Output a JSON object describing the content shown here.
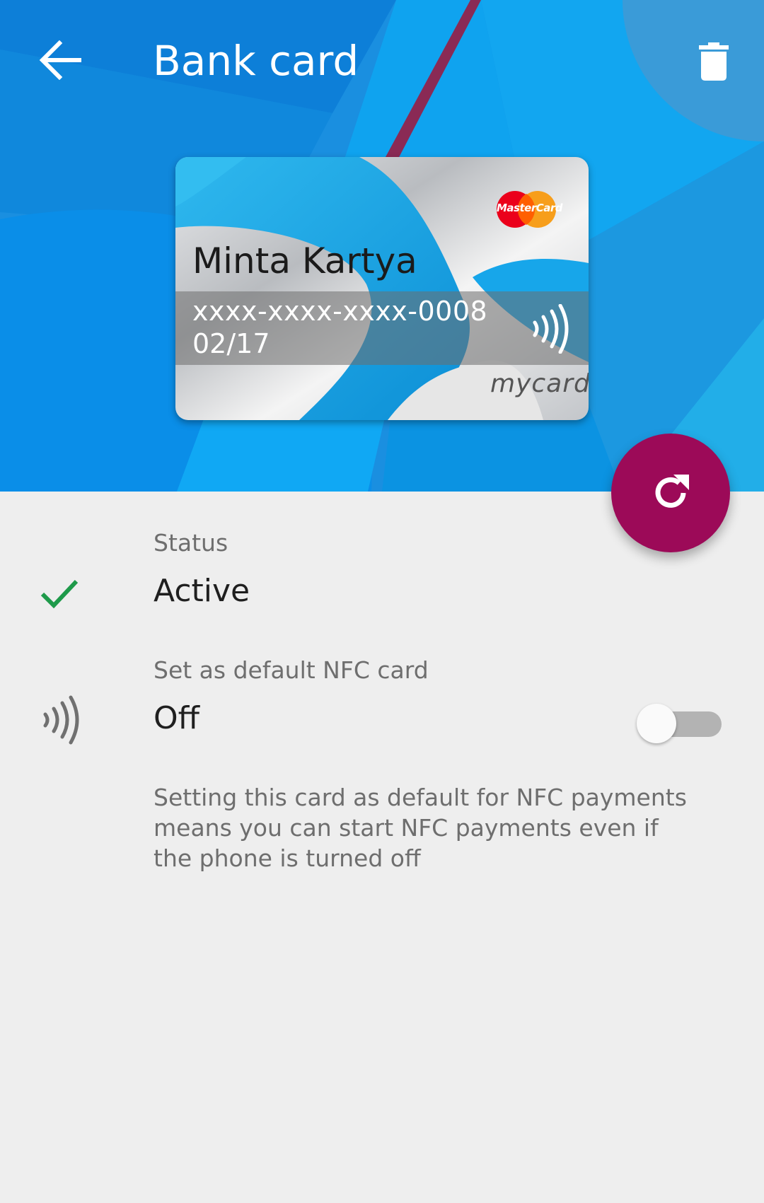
{
  "app_bar": {
    "title": "Bank card",
    "back_icon": "arrow-left-icon",
    "delete_icon": "trash-icon"
  },
  "card": {
    "holder_name": "Minta Kartya",
    "number": "xxxx-xxxx-xxxx-0008",
    "expiry": "02/17",
    "network_logo": "MasterCard",
    "brand": "mycard"
  },
  "fab": {
    "icon": "refresh-icon",
    "color": "#9c0a58"
  },
  "status": {
    "label": "Status",
    "value": "Active",
    "icon": "check-icon",
    "icon_color": "#1e9a4a"
  },
  "nfc_default": {
    "label": "Set as default NFC card",
    "value": "Off",
    "icon": "nfc-icon",
    "enabled": false,
    "description": "Setting this card as default for NFC payments means you can start NFC payments even if the phone is turned off"
  },
  "colors": {
    "hero_blue": "#1a8fe0",
    "accent": "#9c0a58",
    "background": "#eeeeee"
  }
}
